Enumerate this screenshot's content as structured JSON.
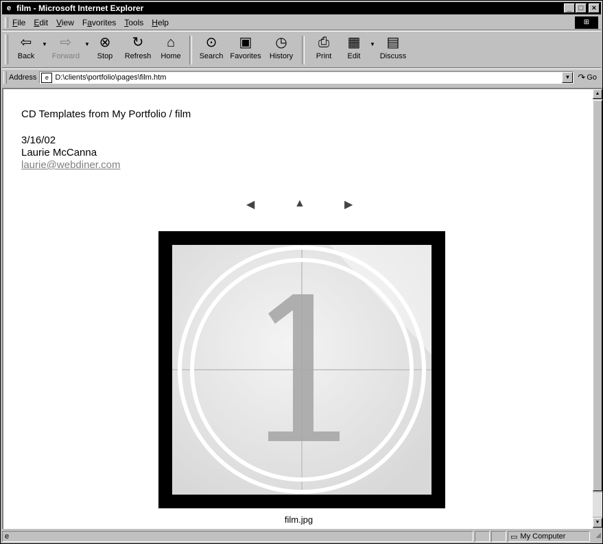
{
  "window": {
    "title": "film - Microsoft Internet Explorer",
    "controls": [
      "_",
      "□",
      "×"
    ]
  },
  "menu": {
    "items": [
      {
        "key": "F",
        "rest": "ile"
      },
      {
        "key": "E",
        "rest": "dit"
      },
      {
        "key": "V",
        "rest": "iew"
      },
      {
        "key": "a",
        "pre": "F",
        "rest": "vorites"
      },
      {
        "key": "T",
        "rest": "ools"
      },
      {
        "key": "H",
        "rest": "elp"
      }
    ]
  },
  "toolbar": {
    "back": "Back",
    "forward": "Forward",
    "stop": "Stop",
    "refresh": "Refresh",
    "home": "Home",
    "search": "Search",
    "favorites": "Favorites",
    "history": "History",
    "print": "Print",
    "edit": "Edit",
    "discuss": "Discuss"
  },
  "address": {
    "label": "Address",
    "value": "D:\\clients\\portfolio\\pages\\film.htm",
    "go": "Go"
  },
  "page": {
    "heading": "CD Templates from My Portfolio / film",
    "date": "3/16/02",
    "author": "Laurie McCanna",
    "email": "laurie@webdiner.com",
    "caption": "film.jpg"
  },
  "status": {
    "zone": "My Computer"
  }
}
